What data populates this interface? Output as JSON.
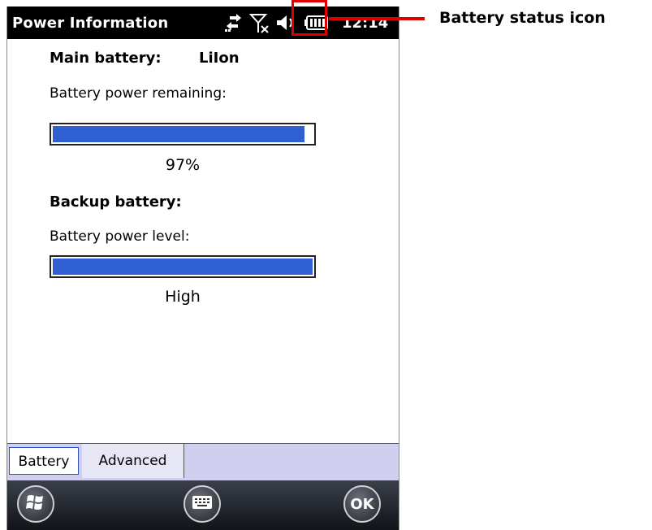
{
  "title_bar": {
    "title": "Power Information",
    "time": "12:14",
    "icons": [
      "data-transfer-icon",
      "no-signal-icon",
      "speaker-icon",
      "battery-icon"
    ]
  },
  "annotation": {
    "label": "Battery status icon",
    "color": "#e00000"
  },
  "main_battery": {
    "heading_label": "Main battery:",
    "type_value": "LiIon",
    "remaining_label": "Battery power remaining:",
    "percent_text": "97%",
    "fill_fraction": 0.97
  },
  "backup_battery": {
    "heading_label": "Backup battery:",
    "level_label": "Battery power level:",
    "level_text": "High",
    "fill_fraction": 1.0
  },
  "tabs": [
    {
      "label": "Battery",
      "active": true
    },
    {
      "label": "Advanced",
      "active": false
    }
  ],
  "softkeys": {
    "start_icon": "windows-start-icon",
    "keyboard_icon": "keyboard-icon",
    "ok_label": "OK"
  },
  "colors": {
    "progress_fill": "#2f5fd0",
    "tab_strip": "#d0cfef",
    "title_bar": "#000000"
  }
}
